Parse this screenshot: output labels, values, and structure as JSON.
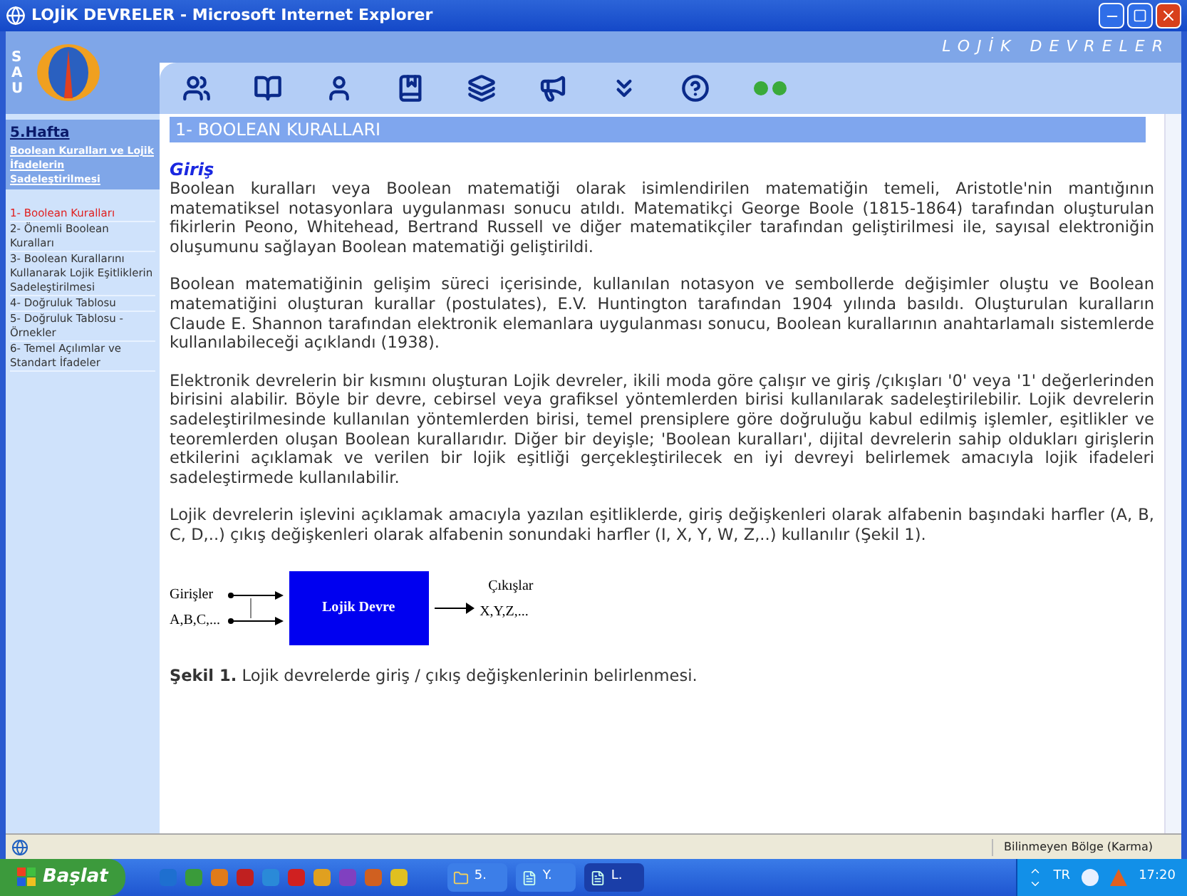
{
  "window": {
    "title": "LOJİK DEVRELER - Microsoft Internet Explorer"
  },
  "header": {
    "logo_text": "SAU",
    "banner": "LOJİK DEVRELER"
  },
  "sidebar": {
    "week": "5.Hafta",
    "topic": "Boolean Kuralları ve Lojik İfadelerin Sadeleştirilmesi",
    "items": [
      {
        "label": "1- Boolean Kuralları",
        "selected": true
      },
      {
        "label": "2- Önemli Boolean Kuralları",
        "selected": false
      },
      {
        "label": "3- Boolean Kurallarını Kullanarak Lojik Eşitliklerin Sadeleştirilmesi",
        "selected": false
      },
      {
        "label": "4- Doğruluk Tablosu",
        "selected": false
      },
      {
        "label": "5- Doğruluk Tablosu - Örnekler",
        "selected": false
      },
      {
        "label": "6- Temel Açılımlar ve Standart İfadeler",
        "selected": false
      }
    ]
  },
  "content": {
    "heading": "1- BOOLEAN KURALLARI",
    "subheading": "Giriş",
    "paragraphs": [
      "Boolean kuralları veya Boolean matematiği olarak isimlendirilen matematiğin temeli, Aristotle'nin mantığının matematiksel notasyonlara uygulanması sonucu atıldı. Matematikçi George Boole (1815-1864) tarafından oluşturulan fikirlerin Peono, Whitehead, Bertrand Russell ve diğer matematikçiler tarafından geliştirilmesi ile, sayısal elektroniğin oluşumunu sağlayan Boolean matematiği geliştirildi.",
      "Boolean matematiğinin gelişim süreci içerisinde, kullanılan notasyon ve sembollerde değişimler oluştu ve Boolean matematiğini oluşturan kurallar (postulates), E.V. Huntington tarafından 1904 yılında basıldı. Oluşturulan kuralların Claude E. Shannon tarafından elektronik elemanlara uygulanması sonucu, Boolean kurallarının anahtarlamalı sistemlerde kullanılabileceği açıklandı (1938).",
      "Elektronik devrelerin bir kısmını oluşturan Lojik devreler, ikili moda göre çalışır ve giriş /çıkışları '0' veya '1' değerlerinden birisini alabilir. Böyle bir devre, cebirsel veya grafiksel yöntemlerden birisi kullanılarak sadeleştirilebilir. Lojik devrelerin sadeleştirilmesinde kullanılan yöntemlerden birisi, temel prensiplere göre doğruluğu kabul edilmiş işlemler, eşitlikler ve teoremlerden oluşan Boolean kurallarıdır. Diğer bir deyişle; 'Boolean kuralları', dijital devrelerin sahip oldukları girişlerin etkilerini açıklamak ve verilen bir lojik eşitliği gerçekleştirilecek en iyi devreyi belirlemek amacıyla lojik ifadeleri sadeleştirmede kullanılabilir.",
      "Lojik devrelerin işlevini açıklamak amacıyla yazılan eşitliklerde, giriş değişkenleri olarak alfabenin başındaki harfler (A, B, C, D,..) çıkış değişkenleri olarak alfabenin sonundaki harfler (I, X, Y, W, Z,..) kullanılır (Şekil 1)."
    ],
    "figure": {
      "inputs_label": "Girişler",
      "inputs": "A,B,C,...",
      "block": "Lojik Devre",
      "outputs_label": "Çıkışlar",
      "outputs": "X,Y,Z,...",
      "caption": "**Şekil 1.** Lojik devrelerde giriş / çıkış değişkenlerinin belirlenmesi."
    }
  },
  "status_bar": {
    "zone": "Bilinmeyen Bölge (Karma)"
  },
  "taskbar": {
    "start": "Başlat",
    "tasks": [
      {
        "label": "5.",
        "selected": false
      },
      {
        "label": "Y.",
        "selected": false
      },
      {
        "label": "L.",
        "selected": true
      }
    ],
    "language": "TR",
    "clock": "17:20"
  }
}
